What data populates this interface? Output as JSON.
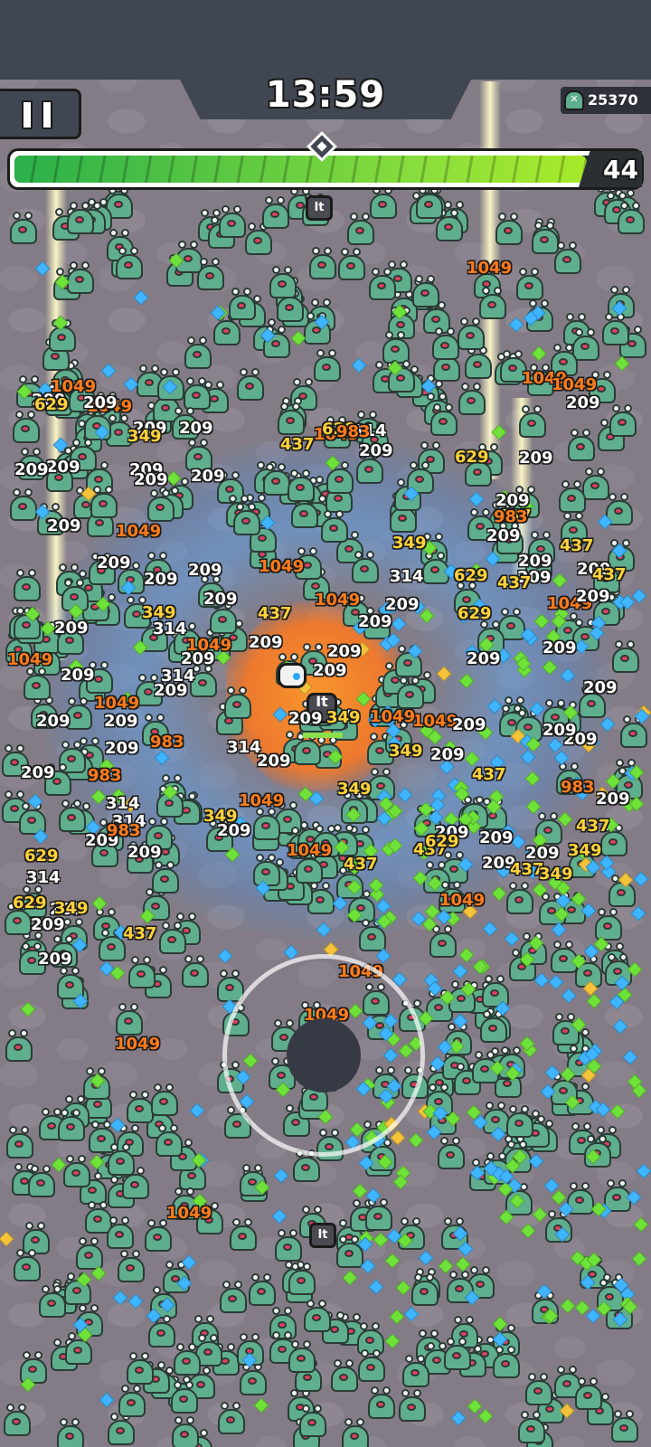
{
  "hud": {
    "timer": "13:59",
    "kill_count": "25370",
    "level": "44",
    "xp_progress": 0.92,
    "pause_icon": "pause-icon",
    "kill_icon": "skull-slime-icon"
  },
  "player": {
    "hp_fraction": 1.0,
    "glyph": "It"
  },
  "drone": {
    "name": "robot-drone-icon"
  },
  "damage_numbers": [
    "1049",
    "1049",
    "1049",
    "1049",
    "1049",
    "1049",
    "1049",
    "1049",
    "1049",
    "1049",
    "1049",
    "1049",
    "1049",
    "1049",
    "1049",
    "1049",
    "1049",
    "1049",
    "1049",
    "1049",
    "1049",
    "1049",
    "209",
    "209",
    "209",
    "209",
    "209",
    "209",
    "209",
    "209",
    "209",
    "209",
    "209",
    "209",
    "209",
    "209",
    "209",
    "209",
    "209",
    "209",
    "209",
    "209",
    "209",
    "209",
    "209",
    "209",
    "209",
    "209",
    "209",
    "209",
    "209",
    "209",
    "209",
    "209",
    "209",
    "209",
    "209",
    "209",
    "209",
    "209",
    "209",
    "209",
    "209",
    "209",
    "209",
    "209",
    "209",
    "209",
    "209",
    "209",
    "209",
    "209",
    "209",
    "209",
    "209",
    "209",
    "209",
    "209",
    "437",
    "437",
    "437",
    "437",
    "437",
    "437",
    "437",
    "437",
    "437",
    "437",
    "437",
    "437",
    "349",
    "349",
    "349",
    "349",
    "349",
    "349",
    "349",
    "349",
    "349",
    "349",
    "314",
    "314",
    "314",
    "314",
    "314",
    "314",
    "314",
    "314",
    "629",
    "629",
    "629",
    "629",
    "629",
    "629",
    "629",
    "629",
    "983",
    "983",
    "983",
    "983",
    "983",
    "983"
  ],
  "colors": {
    "enemy": "#5fae8e",
    "xp_start": "#2ab04a",
    "xp_end": "#a8ea2a",
    "gem_blue": "#3fb4ff",
    "gem_green": "#6fe23a",
    "explosion": "#ff8a2a"
  }
}
